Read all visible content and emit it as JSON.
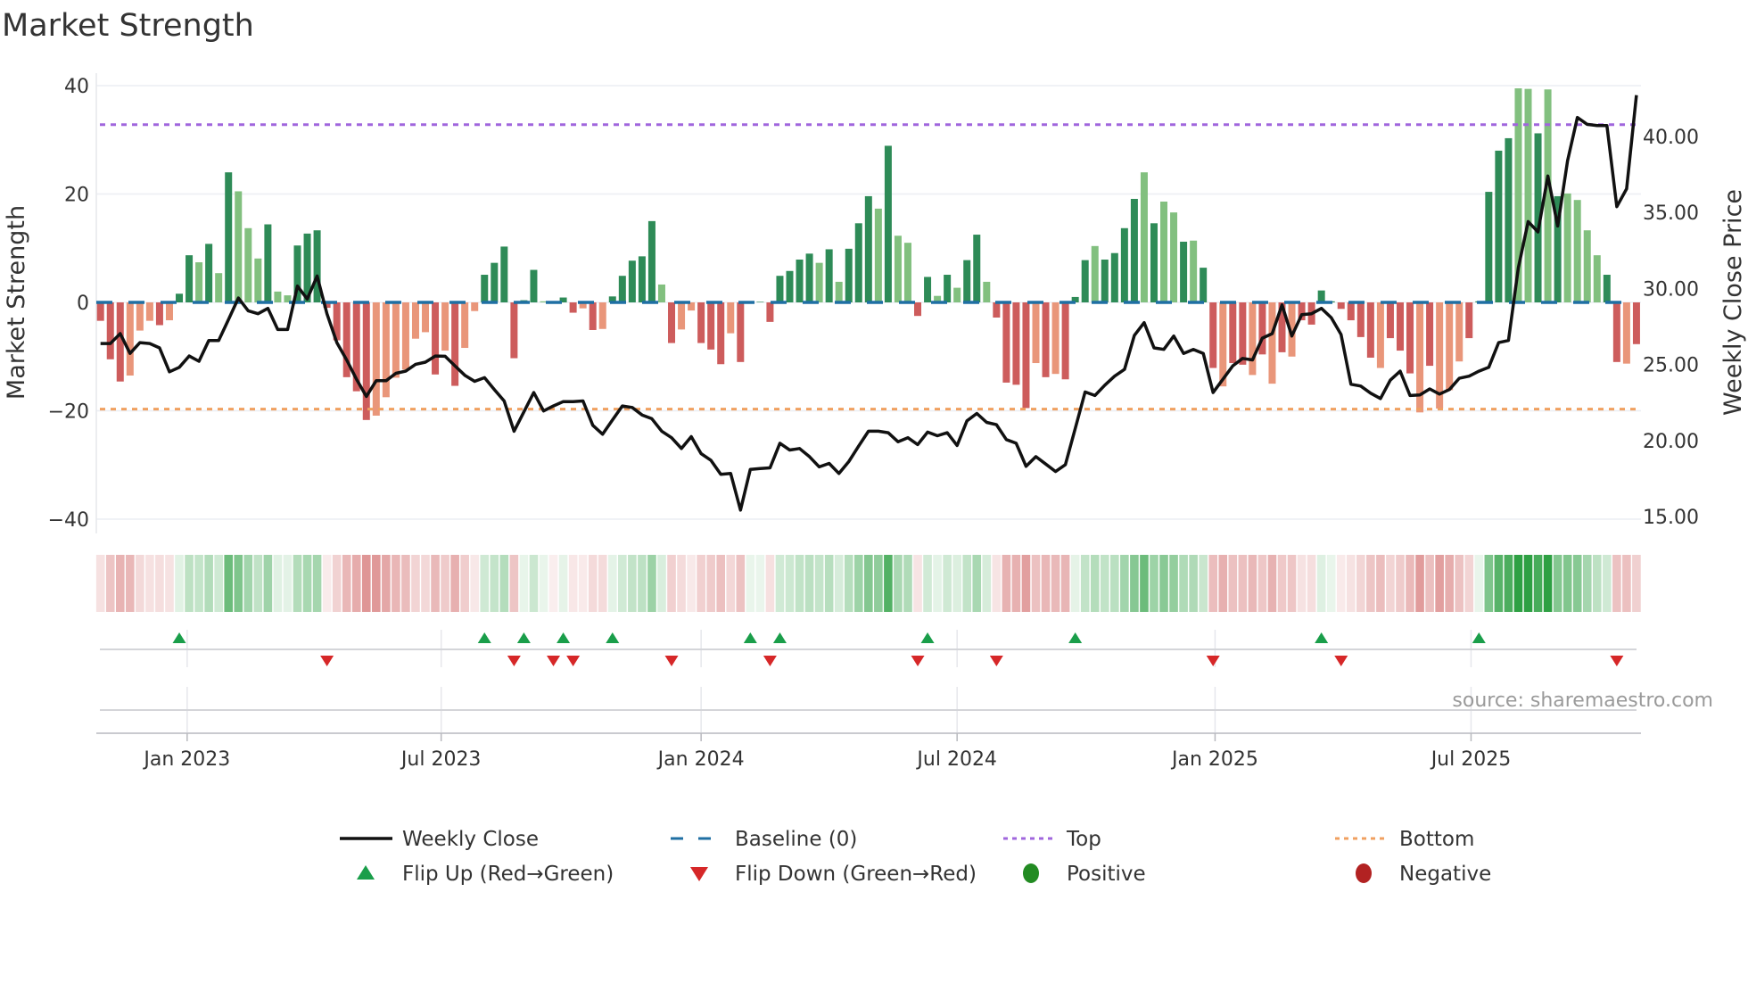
{
  "title": "Market Strength",
  "source": "source: sharemaestro.com",
  "colors": {
    "green_dark": "#2e8b57",
    "green_light": "#82c07f",
    "red_dark": "#cd5c5c",
    "red_light": "#e9967a",
    "line": "#111111",
    "baseline": "#1f6fa3",
    "top": "#a066dd",
    "bottom": "#f0a060",
    "flip_up": "#1a9e4a",
    "flip_down": "#d62728",
    "positive": "#228b22",
    "negative": "#b22222"
  },
  "legend": {
    "weekly_close": "Weekly Close",
    "baseline": "Baseline (0)",
    "top": "Top",
    "bottom": "Bottom",
    "flip_up": "Flip Up (Red→Green)",
    "flip_down": "Flip Down (Green→Red)",
    "positive": "Positive",
    "negative": "Negative"
  },
  "chart_data": {
    "type": "bar",
    "title": "Market Strength",
    "ylabel": "Market Strength",
    "y2label": "Weekly Close Price",
    "ylim": [
      -42,
      42
    ],
    "y2lim": [
      14.3,
      43.6
    ],
    "yticks": [
      "40",
      "20",
      "0",
      "−20",
      "−40"
    ],
    "ytick_values": [
      40,
      20,
      0,
      -20,
      -40
    ],
    "y2ticks": [
      "40.00",
      "35.00",
      "30.00",
      "25.00",
      "20.00",
      "15.00"
    ],
    "y2tick_values": [
      40,
      35,
      30,
      25,
      20,
      15
    ],
    "xticks": [
      "Jan 2023",
      "Jul 2023",
      "Jan 2024",
      "Jul 2024",
      "Jan 2025",
      "Jul 2025"
    ],
    "xtick_week_index": [
      8.8,
      34.6,
      61.0,
      87.0,
      113.2,
      139.2
    ],
    "top_level": 32.8,
    "bottom_level": -19.7,
    "baseline": 0,
    "strength": [
      -3.4,
      -10.5,
      -14.6,
      -13.5,
      -5.2,
      -3.4,
      -4.2,
      -3.3,
      1.6,
      8.7,
      7.4,
      10.8,
      5.4,
      24,
      20.5,
      13.7,
      8.1,
      14.4,
      2,
      1.3,
      10.5,
      12.7,
      13.3,
      -1,
      -7,
      -13.8,
      -16.4,
      -21.7,
      -20.9,
      -17.5,
      -13.9,
      -12.4,
      -6.7,
      -5.5,
      -13.3,
      -8.9,
      -15.4,
      -8.4,
      -1.6,
      5.1,
      7.3,
      10.3,
      -10.3,
      0.4,
      6,
      0.2,
      -0.2,
      0.9,
      -1.9,
      -1.1,
      -5.1,
      -4.9,
      1.1,
      4.9,
      7.7,
      8.5,
      15,
      3.3,
      -7.5,
      -5,
      -1.5,
      -7.5,
      -8.7,
      -11.4,
      -5.7,
      -11,
      0.2,
      0.1,
      -3.6,
      4.9,
      5.8,
      7.9,
      9,
      7.3,
      9.8,
      3.8,
      9.9,
      14.6,
      19.6,
      17.3,
      28.9,
      12.3,
      11,
      -2.5,
      4.7,
      1.2,
      5.1,
      2.7,
      7.8,
      12.5,
      3.8,
      -2.8,
      -14.8,
      -15.2,
      -19.5,
      -11.2,
      -13.8,
      -13.2,
      -14.2,
      1,
      7.8,
      10.4,
      7.9,
      9.1,
      13.7,
      19.1,
      24,
      14.6,
      18.6,
      16.6,
      11.2,
      11.4,
      6.4,
      -12.1,
      -15.5,
      -11.2,
      -11.5,
      -13.4,
      -9.6,
      -15,
      -9.2,
      -10,
      -3.3,
      -4.1,
      2.2,
      0.2,
      -1.2,
      -3.3,
      -6.4,
      -10.2,
      -12.1,
      -6.6,
      -8.9,
      -13.1,
      -20.3,
      -11.7,
      -19.6,
      -16.2,
      -10.9,
      -6.6,
      0.2,
      20.4,
      28,
      30.3,
      39.5,
      39.4,
      31.2,
      39.3,
      19.6,
      20.1,
      18.9,
      13.3,
      8.7,
      5.1,
      -11,
      -11.3,
      -7.7
    ],
    "bar_shades": "dddllldlddldldllldllddddddddlllllldldllddddddldddldldddddldlldddlddddddddldldddldllddldlddlddddldldddlddddldlldlddlddldldlddddddddldddldlllddddd lldldllllddl",
    "weekly_close": [
      26.38,
      26.38,
      27.03,
      25.73,
      26.44,
      26.38,
      26.09,
      24.52,
      24.81,
      25.56,
      25.21,
      26.58,
      26.58,
      27.95,
      29.37,
      28.53,
      28.34,
      28.69,
      27.3,
      27.3,
      30.16,
      29.31,
      30.82,
      28.34,
      26.44,
      25.3,
      24.03,
      22.9,
      23.93,
      23.93,
      24.42,
      24.56,
      25.01,
      25.15,
      25.56,
      25.54,
      24.91,
      24.29,
      23.89,
      24.13,
      23.35,
      22.6,
      20.61,
      21.88,
      23.15,
      21.94,
      22.27,
      22.56,
      22.56,
      22.6,
      21.0,
      20.41,
      21.35,
      22.27,
      22.17,
      21.68,
      21.43,
      20.61,
      20.18,
      19.47,
      20.25,
      19.14,
      18.69,
      17.77,
      17.83,
      15.42,
      18.1,
      18.16,
      18.2,
      19.82,
      19.37,
      19.47,
      18.94,
      18.26,
      18.49,
      17.83,
      18.61,
      19.63,
      20.61,
      20.61,
      20.51,
      19.92,
      20.18,
      19.73,
      20.55,
      20.31,
      20.51,
      19.67,
      21.29,
      21.78,
      21.19,
      21.04,
      20.06,
      19.82,
      18.3,
      18.94,
      18.45,
      17.96,
      18.41,
      20.8,
      23.19,
      22.96,
      23.64,
      24.23,
      24.68,
      26.91,
      27.75,
      26.09,
      25.99,
      26.87,
      25.73,
      25.99,
      25.73,
      23.15,
      24.03,
      24.91,
      25.4,
      25.3,
      26.73,
      27.03,
      28.92,
      26.87,
      28.28,
      28.34,
      28.69,
      28.08,
      26.97,
      23.7,
      23.58,
      23.11,
      22.76,
      23.97,
      24.56,
      22.96,
      23.0,
      23.39,
      23.05,
      23.35,
      24.09,
      24.23,
      24.56,
      24.81,
      26.44,
      26.58,
      31.37,
      34.4,
      33.72,
      37.4,
      34.11,
      38.41,
      41.25,
      40.8,
      40.72,
      40.72,
      35.38,
      36.56,
      42.72
    ],
    "flip_up_weeks": [
      9,
      40,
      44,
      48,
      53,
      67,
      70,
      85,
      100,
      125,
      141
    ],
    "flip_down_weeks": [
      24,
      43,
      47,
      49,
      59,
      69,
      84,
      92,
      114,
      127,
      155
    ]
  }
}
